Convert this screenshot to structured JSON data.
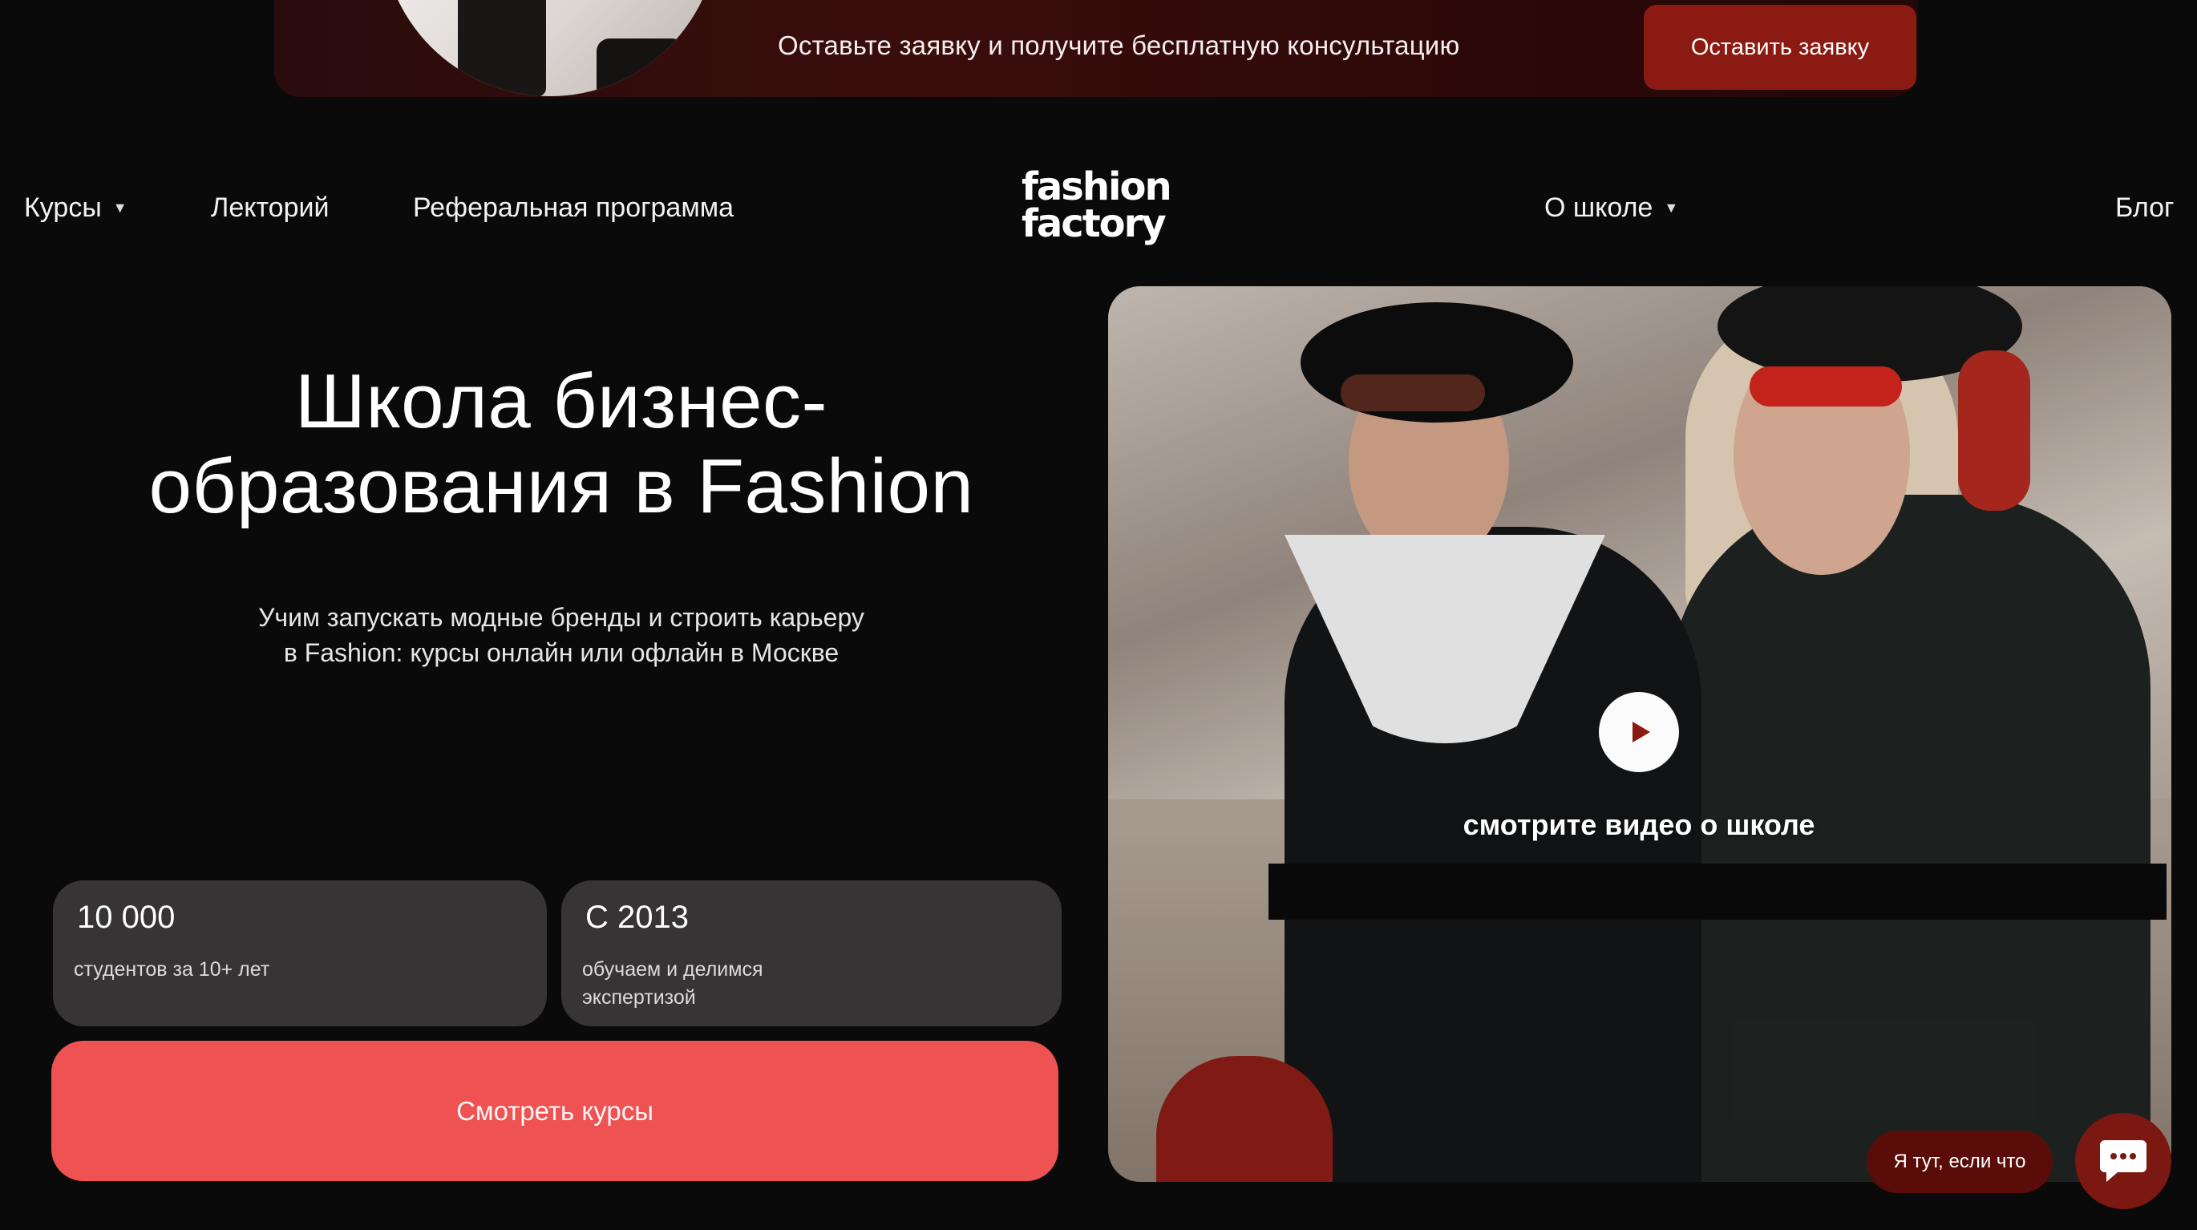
{
  "banner": {
    "text": "Оставьте заявку и получите бесплатную консультацию",
    "button_label": "Оставить заявку"
  },
  "nav": {
    "courses": "Курсы",
    "lectures": "Лекторий",
    "referral": "Реферальная программа",
    "about": "О школе",
    "blog": "Блог"
  },
  "logo": {
    "line1": "fashion",
    "line2": "factory"
  },
  "hero": {
    "title_line1": "Школа бизнес-",
    "title_line2": "образования в Fashion",
    "subtitle_line1": "Учим запускать модные бренды и строить карьеру",
    "subtitle_line2": "в Fashion: курсы онлайн или офлайн в Москве"
  },
  "stats": [
    {
      "value": "10 000",
      "label_line1": "студентов за 10+ лет",
      "label_line2": ""
    },
    {
      "value": "С 2013",
      "label_line1": "обучаем и делимся",
      "label_line2": "экспертизой"
    }
  ],
  "cta": {
    "label": "Смотреть курсы"
  },
  "video": {
    "caption": "смотрите видео о школе"
  },
  "chat": {
    "bubble": "Я тут, если что"
  },
  "icons": {
    "caret": "caret-down-icon",
    "play": "play-icon",
    "chat": "chat-icon"
  },
  "colors": {
    "background": "#0b0a0a",
    "banner_button": "#8b1b12",
    "cta": "#ee5252",
    "stat_card": "#363435",
    "chat_bubble": "#5a0d08",
    "play_triangle": "#8b1b12"
  }
}
